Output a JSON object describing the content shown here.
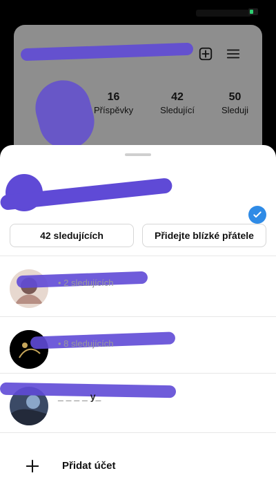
{
  "profile_background": {
    "stats": [
      {
        "number": "16",
        "label": "Příspěvky"
      },
      {
        "number": "42",
        "label": "Sledující"
      },
      {
        "number": "50",
        "label": "Sleduji"
      }
    ]
  },
  "sheet": {
    "buttons": {
      "followers": "42 sledujících",
      "close_friends": "Přidejte blízké přátele"
    },
    "accounts": [
      {
        "name": "",
        "sub": "• 2 sledujících"
      },
      {
        "name": "",
        "sub": "• 8 sledujících"
      },
      {
        "name": "_ _ _ _ y_",
        "sub": ""
      }
    ],
    "add_account_label": "Přidat účet"
  },
  "colors": {
    "accent": "#2f8be6",
    "blur": "#5f4ad6",
    "sheet_bg": "#ffffff",
    "card_bg": "#8e8e8e"
  },
  "icons": [
    "add-square-icon",
    "menu-icon",
    "check-circle-icon",
    "plus-icon"
  ]
}
